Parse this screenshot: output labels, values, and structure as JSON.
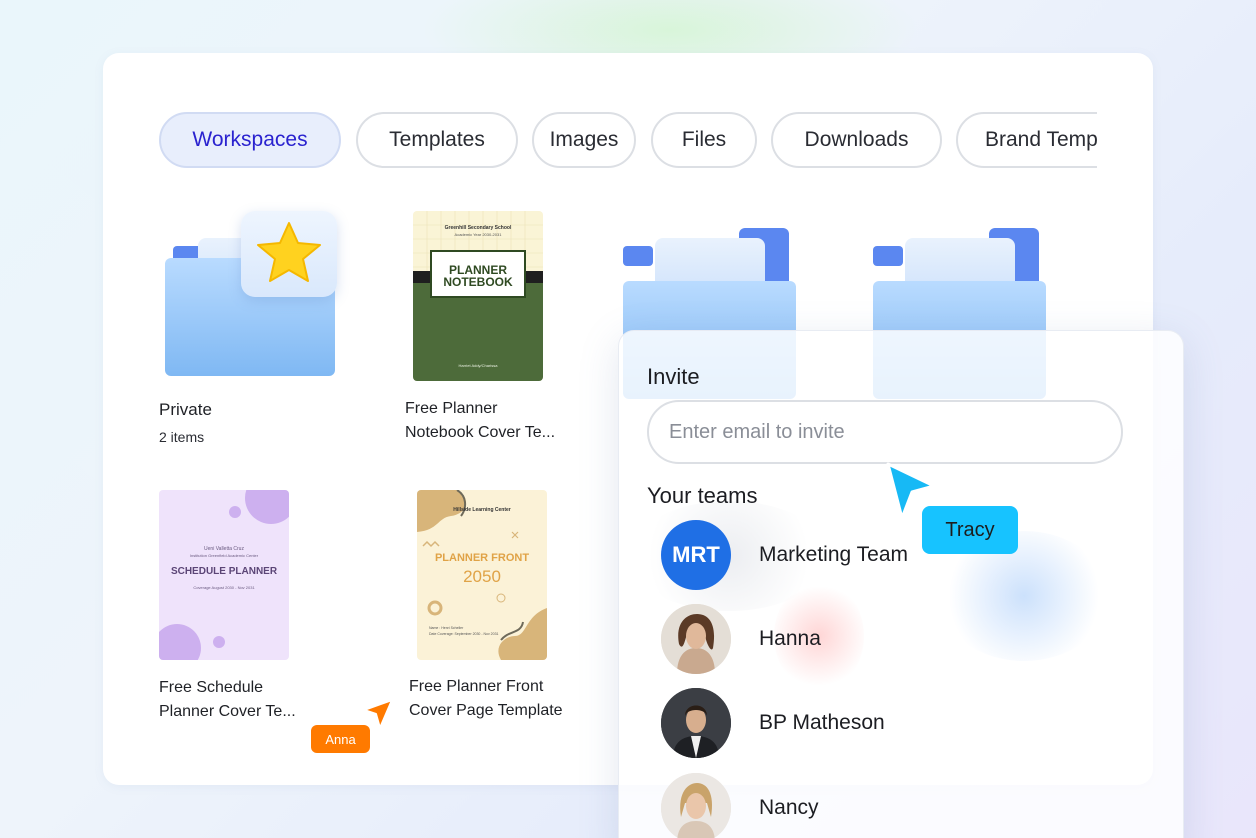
{
  "tabs": [
    "Workspaces",
    "Templates",
    "Images",
    "Files",
    "Downloads",
    "Brand Templates"
  ],
  "items": [
    {
      "title": "Private",
      "subtitle": "2 items"
    },
    {
      "title": "Free Planner Notebook Cover Te...",
      "line1": "Free Planner",
      "line2": "Notebook Cover Te..."
    },
    {
      "title": "Free Schedule Planner Cover Te...",
      "line1": "Free Schedule",
      "line2": "Planner Cover Te..."
    },
    {
      "title": "Free Planner Front Cover Page Template",
      "line1": "Free Planner Front",
      "line2": "Cover Page Template"
    }
  ],
  "thumb_notebook": {
    "school": "Greenhill Secondary School",
    "year": "Academic Year 2030-2031",
    "title1": "PLANNER",
    "title2": "NOTEBOOK",
    "author": "Harriet Addy/Charissa"
  },
  "thumb_schedule": {
    "top1": "Ueni Valletta Cruz",
    "top2": "Institution Greenfield Academic Center",
    "title": "SCHEDULE PLANNER",
    "dates": "Coverage August 2030 - Nov 2031"
  },
  "thumb_front": {
    "header": "Hillside Learning Center",
    "title": "PLANNER FRONT",
    "year": "2050",
    "foot1": "Name : Henri Scheller",
    "foot2": "Date Coverage: September 2030 - Nov 2031"
  },
  "invite": {
    "heading": "Invite",
    "placeholder": "Enter email to invite",
    "teams_heading": "Your teams",
    "members": [
      {
        "name": "Marketing Team",
        "initials": "MRT"
      },
      {
        "name": "Hanna"
      },
      {
        "name": "BP Matheson"
      },
      {
        "name": "Nancy"
      }
    ]
  },
  "cursors": [
    {
      "label": "Anna",
      "color": "#ff7a00"
    },
    {
      "label": "Tracy",
      "color": "#17b9f5"
    }
  ],
  "colors": {
    "accent": "#2a22cf",
    "active_tab_bg": "#e8eefc",
    "avatar_blue": "#1f6fe5"
  },
  "icons": [
    "star-icon",
    "folder-icon",
    "cursor-arrow-icon"
  ]
}
